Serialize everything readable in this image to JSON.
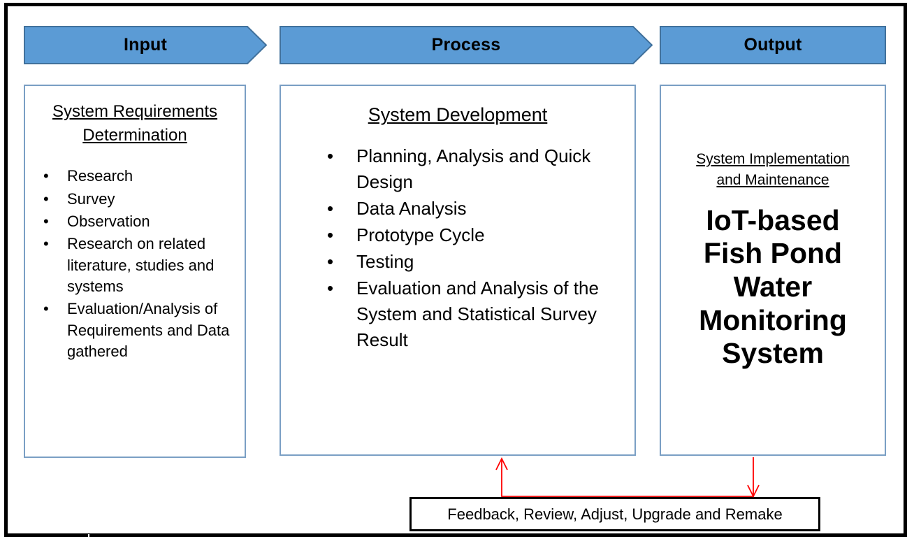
{
  "diagram": {
    "title": "IPO Conceptual Framework",
    "accent_blue": "#5B9BD5",
    "box_border_color": "#7A9FC4",
    "arrow_color": "#FF0000",
    "frame_color": "#000000"
  },
  "banners": {
    "input": "Input",
    "process": "Process",
    "output": "Output"
  },
  "input_box": {
    "title_line1": "System Requirements",
    "title_line2": "Determination",
    "bullets": [
      "Research",
      "Survey",
      "Observation",
      "Research on related literature, studies and systems",
      "Evaluation/Analysis of Requirements and Data gathered"
    ]
  },
  "process_box": {
    "title": "System Development",
    "bullets": [
      "Planning, Analysis and Quick Design",
      "Data Analysis",
      "Prototype Cycle",
      "Testing",
      "Evaluation and Analysis of the System and Statistical Survey Result"
    ]
  },
  "output_box": {
    "title_line1": "System Implementation",
    "title_line2": "and Maintenance",
    "system_name_line1": "IoT-based",
    "system_name_line2": "Fish Pond",
    "system_name_line3": "Water",
    "system_name_line4": "Monitoring",
    "system_name_line5": "System"
  },
  "feedback": {
    "label": "Feedback, Review, Adjust, Upgrade and Remake"
  },
  "bullet_glyph": "•"
}
